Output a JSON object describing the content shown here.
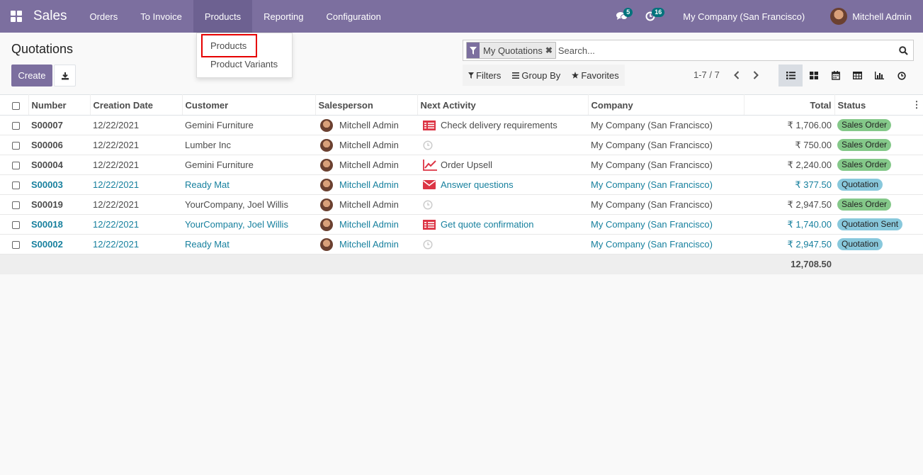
{
  "navbar": {
    "app_name": "Sales",
    "menu": [
      "Orders",
      "To Invoice",
      "Products",
      "Reporting",
      "Configuration"
    ],
    "messages_count": "5",
    "activities_count": "16",
    "company": "My Company (San Francisco)",
    "user": "Mitchell Admin"
  },
  "dropdown": {
    "items": [
      "Products",
      "Product Variants"
    ]
  },
  "control_panel": {
    "title": "Quotations",
    "create_label": "Create",
    "facet_label": "My Quotations",
    "search_placeholder": "Search...",
    "filters_label": "Filters",
    "groupby_label": "Group By",
    "favorites_label": "Favorites",
    "pager": "1-7 / 7"
  },
  "table": {
    "columns": [
      "Number",
      "Creation Date",
      "Customer",
      "Salesperson",
      "Next Activity",
      "Company",
      "Total",
      "Status"
    ],
    "rows": [
      {
        "number": "S00007",
        "date": "12/22/2021",
        "customer": "Gemini Furniture",
        "salesperson": "Mitchell Admin",
        "activity": "Check delivery requirements",
        "activity_icon": "checklist-icon",
        "company": "My Company (San Francisco)",
        "total": "₹ 1,706.00",
        "status": "Sales Order"
      },
      {
        "number": "S00006",
        "date": "12/22/2021",
        "customer": "Lumber Inc",
        "salesperson": "Mitchell Admin",
        "activity": "",
        "activity_icon": "clock-icon",
        "company": "My Company (San Francisco)",
        "total": "₹ 750.00",
        "status": "Sales Order"
      },
      {
        "number": "S00004",
        "date": "12/22/2021",
        "customer": "Gemini Furniture",
        "salesperson": "Mitchell Admin",
        "activity": "Order Upsell",
        "activity_icon": "line-chart-icon",
        "company": "My Company (San Francisco)",
        "total": "₹ 2,240.00",
        "status": "Sales Order"
      },
      {
        "number": "S00003",
        "date": "12/22/2021",
        "customer": "Ready Mat",
        "salesperson": "Mitchell Admin",
        "activity": "Answer questions",
        "activity_icon": "envelope-icon",
        "company": "My Company (San Francisco)",
        "total": "₹ 377.50",
        "status": "Quotation"
      },
      {
        "number": "S00019",
        "date": "12/22/2021",
        "customer": "YourCompany, Joel Willis",
        "salesperson": "Mitchell Admin",
        "activity": "",
        "activity_icon": "clock-icon",
        "company": "My Company (San Francisco)",
        "total": "₹ 2,947.50",
        "status": "Sales Order"
      },
      {
        "number": "S00018",
        "date": "12/22/2021",
        "customer": "YourCompany, Joel Willis",
        "salesperson": "Mitchell Admin",
        "activity": "Get quote confirmation",
        "activity_icon": "checklist-icon",
        "company": "My Company (San Francisco)",
        "total": "₹ 1,740.00",
        "status": "Quotation Sent"
      },
      {
        "number": "S00002",
        "date": "12/22/2021",
        "customer": "Ready Mat",
        "salesperson": "Mitchell Admin",
        "activity": "",
        "activity_icon": "clock-icon",
        "company": "My Company (San Francisco)",
        "total": "₹ 2,947.50",
        "status": "Quotation"
      }
    ],
    "grand_total": "12,708.50"
  },
  "colors": {
    "brand": "#7c6f9f",
    "link": "#17809e",
    "activity_red": "#dc3545",
    "status_sale": "#84c889",
    "status_quotation": "#88c8dc"
  }
}
